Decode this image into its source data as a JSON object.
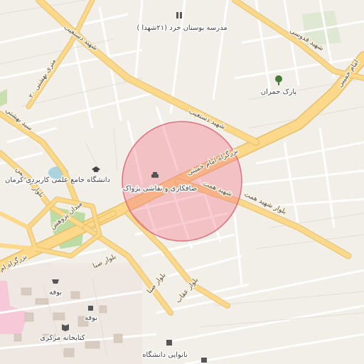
{
  "map": {
    "area_label": "kerman-map",
    "colors": {
      "background": "#f2efe9",
      "major_road": "#fbd88a",
      "major_road_casing": "#e6bf6a",
      "minor_road": "#ffffff",
      "park": "#c8e0b0",
      "water": "#aad3df",
      "campus": "#efe6dd",
      "highlight_fill": "rgba(240,110,130,0.35)",
      "highlight_stroke": "#e0707f"
    },
    "roads": {
      "imam_khomeini": "بزرگراه امام خمینی",
      "imam_khomeini_short": "بزرگراه ام",
      "imam_khomeini_ne": "امام خمینی",
      "dastgheib_n": "شهید دستغیب",
      "dastgheib_s": "شهید دستغیب",
      "ghodousi": "شهید قدوسی",
      "hemmat_a": "شهید همت",
      "hemmat_b": "بلوار شهید همت",
      "seyed_beheshti": "سید بهشتی",
      "behman22": "بلوار ۲۲ بهمن",
      "behman22_b": "۲۲ بهمن",
      "beheshti20": "۲۰ متری بهشتی",
      "saba_a": "بلوار صبا",
      "saba_b": "بلوار صبا",
      "oghab": "بلوار عقاب",
      "square": "میدان پژوهش"
    },
    "pois": {
      "school": "مدرسه بوستان خرد (۲۱شهدا )",
      "park": "پارک جمران",
      "university": "دانشگاه جامع علمی کاربردی کرمان",
      "carwash": "صافکاری و نقاشی پژواک",
      "bakery1": "بوفه",
      "bakery2": "بوفه",
      "library": "کتابخانه مرکزی",
      "bakery3": "نانوایی دانشگاه"
    },
    "icons": {
      "school": "school-icon",
      "park": "tree-icon",
      "university": "graduation-cap-icon",
      "carwash": "car-icon",
      "bakery1": "basket-icon",
      "bakery2": "cup-icon",
      "library": "book-icon",
      "bakery3": "bakery-icon"
    }
  }
}
